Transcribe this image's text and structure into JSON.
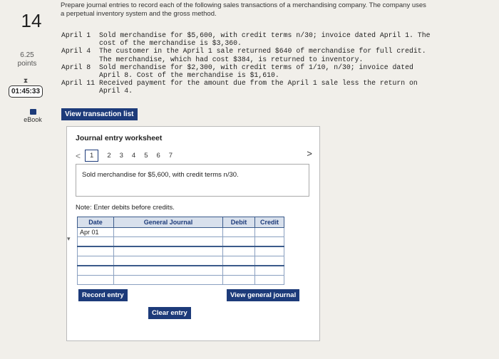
{
  "sidebar": {
    "question_number": "14",
    "points_value": "6.25",
    "points_label": "points",
    "timer": "01:45:33",
    "ebook": "eBook"
  },
  "prompt": "Prepare journal entries to record each of the following sales transactions of a merchandising company. The company uses a perpetual inventory system and the gross method.",
  "events": [
    {
      "date": "April 1",
      "text": "Sold merchandise for $5,600, with credit terms n/30; invoice dated April 1. The cost of the merchandise is $3,360."
    },
    {
      "date": "April 4",
      "text": "The customer in the April 1 sale returned $640 of merchandise for full credit. The merchandise, which had cost $384, is returned to inventory."
    },
    {
      "date": "April 8",
      "text": "Sold merchandise for $2,300, with credit terms of 1/10, n/30; invoice dated April 8. Cost of the merchandise is $1,610."
    },
    {
      "date": "April 11",
      "text": "Received payment for the amount due from the April 1 sale less the return on April 4."
    }
  ],
  "buttons": {
    "view_transaction_list": "View transaction list",
    "record_entry": "Record entry",
    "view_general_journal": "View general journal",
    "clear_entry": "Clear entry"
  },
  "worksheet": {
    "title": "Journal entry worksheet",
    "prev_arrow": "<",
    "next_arrow": ">",
    "pages": [
      "1",
      "2",
      "3",
      "4",
      "5",
      "6",
      "7"
    ],
    "active_page": "1",
    "description": "Sold merchandise for $5,600, with credit terms n/30.",
    "note": "Note: Enter debits before credits.",
    "columns": [
      "Date",
      "General Journal",
      "Debit",
      "Credit"
    ],
    "first_date": "Apr 01"
  }
}
